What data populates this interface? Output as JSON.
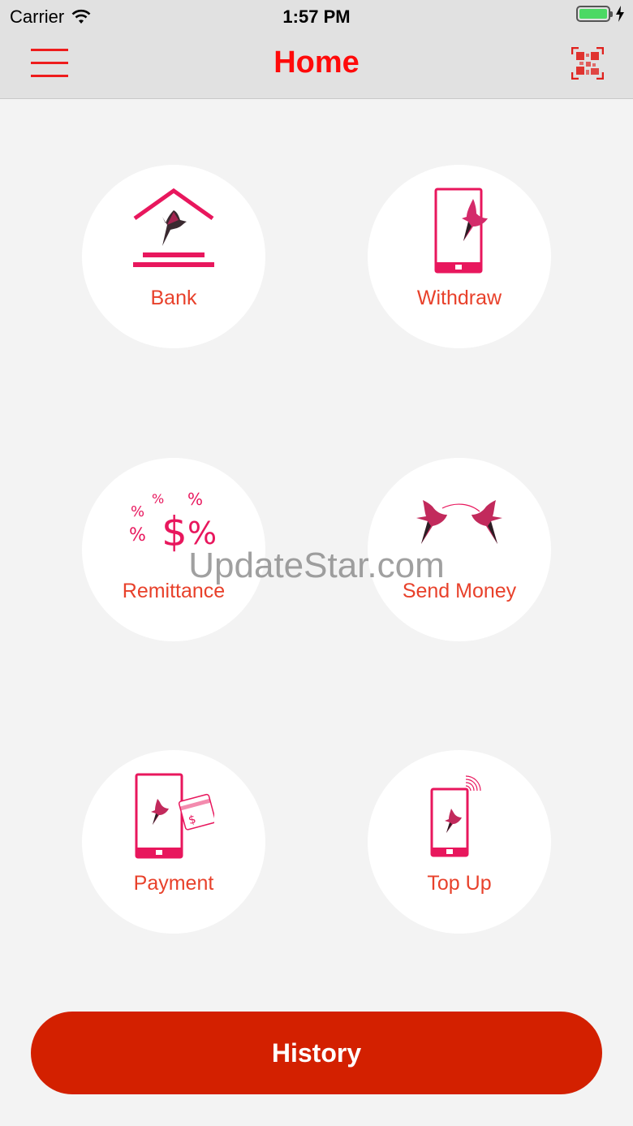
{
  "status_bar": {
    "carrier": "Carrier",
    "time": "1:57 PM",
    "battery_level": 1.0,
    "icons": [
      "wifi-icon",
      "battery-icon",
      "charging-bolt-icon"
    ]
  },
  "nav": {
    "title": "Home",
    "left_icon": "hamburger-menu-icon",
    "right_icon": "qr-code-icon"
  },
  "tiles": [
    {
      "label": "Bank",
      "icon": "bank-bird-icon"
    },
    {
      "label": "Withdraw",
      "icon": "phone-bird-icon"
    },
    {
      "label": "Remittance",
      "icon": "percent-dollar-icon"
    },
    {
      "label": "Send Money",
      "icon": "two-birds-icon"
    },
    {
      "label": "Payment",
      "icon": "phone-card-icon"
    },
    {
      "label": "Top Up",
      "icon": "phone-signal-icon"
    }
  ],
  "watermark": "UpdateStar.com",
  "history_label": "History",
  "colors": {
    "accent": "#ff0a0a",
    "label": "#e8412b",
    "button": "#d32000",
    "icon_pink": "#e8175d",
    "background": "#f3f3f3"
  }
}
